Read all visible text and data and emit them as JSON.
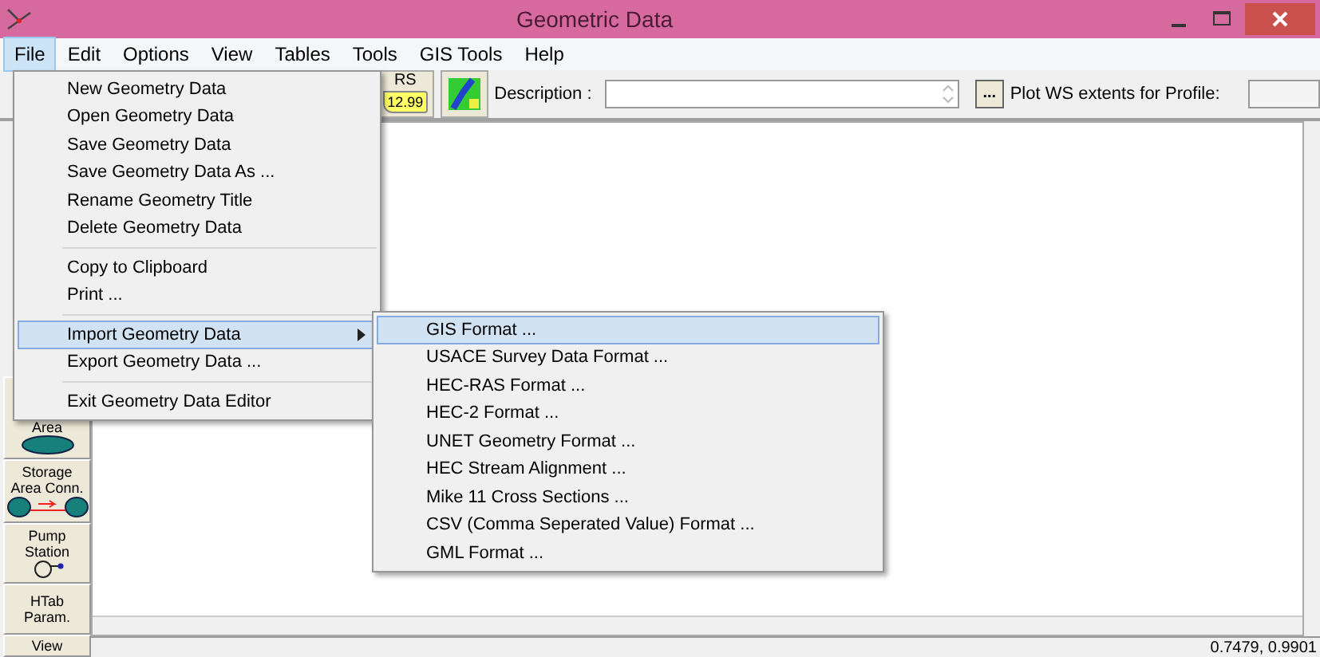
{
  "window": {
    "title": "Geometric Data"
  },
  "menu_bar": [
    {
      "label": "File",
      "selected": true
    },
    {
      "label": "Edit",
      "selected": false
    },
    {
      "label": "Options",
      "selected": false
    },
    {
      "label": "View",
      "selected": false
    },
    {
      "label": "Tables",
      "selected": false
    },
    {
      "label": "Tools",
      "selected": false
    },
    {
      "label": "GIS Tools",
      "selected": false
    },
    {
      "label": "Help",
      "selected": false
    }
  ],
  "toolbar": {
    "rs_button": {
      "label": "RS",
      "value": "12.99"
    },
    "description_label": "Description :",
    "browse_button": "...",
    "plot_label": "Plot WS extents for Profile:"
  },
  "file_menu": [
    {
      "kind": "item",
      "label": "New Geometry Data",
      "selected": false,
      "submenu": false
    },
    {
      "kind": "item",
      "label": "Open Geometry Data",
      "selected": false,
      "submenu": false
    },
    {
      "kind": "item",
      "label": "Save Geometry Data",
      "selected": false,
      "submenu": false
    },
    {
      "kind": "item",
      "label": "Save Geometry Data As ...",
      "selected": false,
      "submenu": false
    },
    {
      "kind": "item",
      "label": "Rename Geometry Title",
      "selected": false,
      "submenu": false
    },
    {
      "kind": "item",
      "label": "Delete Geometry Data",
      "selected": false,
      "submenu": false
    },
    {
      "kind": "separator"
    },
    {
      "kind": "item",
      "label": "Copy to Clipboard",
      "selected": false,
      "submenu": false
    },
    {
      "kind": "item",
      "label": "Print ...",
      "selected": false,
      "submenu": false
    },
    {
      "kind": "separator"
    },
    {
      "kind": "item",
      "label": "Import Geometry Data",
      "selected": true,
      "submenu": true
    },
    {
      "kind": "item",
      "label": "Export Geometry Data ...",
      "selected": false,
      "submenu": false
    },
    {
      "kind": "separator"
    },
    {
      "kind": "item",
      "label": "Exit Geometry Data Editor",
      "selected": false,
      "submenu": false
    }
  ],
  "import_submenu": [
    {
      "label": "GIS Format ...",
      "selected": true
    },
    {
      "label": "USACE Survey Data Format ...",
      "selected": false
    },
    {
      "label": "HEC-RAS Format ...",
      "selected": false
    },
    {
      "label": "HEC-2 Format ...",
      "selected": false
    },
    {
      "label": "UNET Geometry Format ...",
      "selected": false
    },
    {
      "label": "HEC Stream Alignment ...",
      "selected": false
    },
    {
      "label": "Mike 11 Cross Sections ...",
      "selected": false
    },
    {
      "label": "CSV (Comma Seperated Value) Format ...",
      "selected": false
    },
    {
      "label": "GML Format ...",
      "selected": false
    }
  ],
  "tool_palette": [
    {
      "kind": "storage",
      "lines": [
        "Area"
      ]
    },
    {
      "kind": "connection",
      "lines": [
        "Storage",
        "Area Conn."
      ]
    },
    {
      "kind": "pump",
      "lines": [
        "Pump",
        "Station"
      ]
    },
    {
      "kind": "plain",
      "lines": [
        "HTab",
        "Param."
      ]
    },
    {
      "kind": "plain",
      "lines": [
        "View"
      ]
    }
  ],
  "status_bar": {
    "coordinates": "0.7479, 0.9901"
  }
}
